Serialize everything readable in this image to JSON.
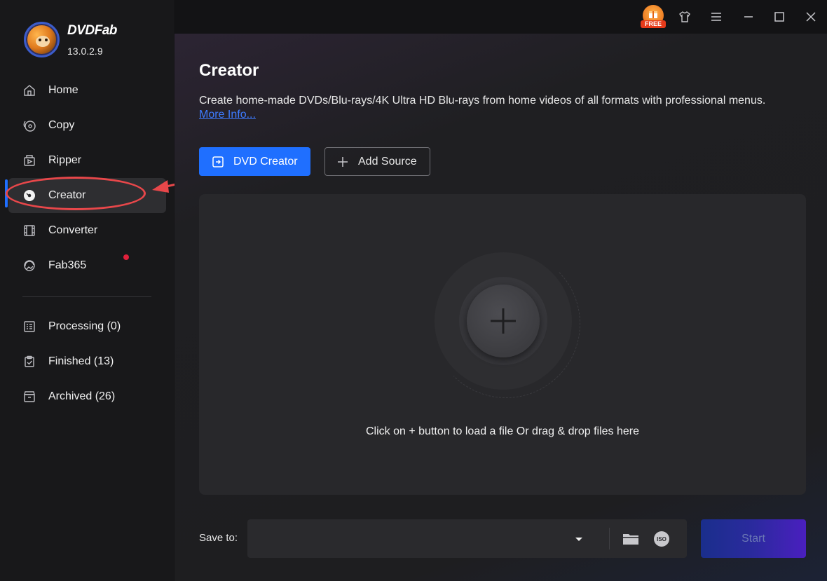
{
  "app": {
    "brand_name": "DVDFab",
    "version": "13.0.2.9"
  },
  "sidebar": {
    "items": [
      {
        "label": "Home",
        "icon": "home-icon"
      },
      {
        "label": "Copy",
        "icon": "copy-icon"
      },
      {
        "label": "Ripper",
        "icon": "ripper-icon"
      },
      {
        "label": "Creator",
        "icon": "creator-disc-icon",
        "active": true
      },
      {
        "label": "Converter",
        "icon": "film-icon"
      },
      {
        "label": "Fab365",
        "icon": "fab365-icon",
        "badge": "dot"
      }
    ],
    "queue": [
      {
        "label": "Processing (0)",
        "icon": "processing-list-icon"
      },
      {
        "label": "Finished (13)",
        "icon": "clipboard-check-icon"
      },
      {
        "label": "Archived (26)",
        "icon": "archive-box-icon"
      }
    ]
  },
  "topbar": {
    "free_badge": "FREE",
    "icons": [
      "free-gift-icon",
      "shirt-skin-icon",
      "menu-icon",
      "minimize-icon",
      "maximize-icon",
      "close-icon"
    ]
  },
  "main": {
    "title": "Creator",
    "description": "Create home-made DVDs/Blu-rays/4K Ultra HD Blu-rays from home videos of all formats with professional menus.",
    "more_info": "More Info...",
    "mode_button": "DVD Creator",
    "add_source_button": "Add Source",
    "drop_hint": "Click on + button to load a file Or drag & drop files here",
    "save_to_label": "Save to:",
    "save_to_value": "",
    "start_button": "Start"
  },
  "colors": {
    "accent": "#1f6fff",
    "annotation": "#e8474a",
    "badge": "#e0203b"
  }
}
